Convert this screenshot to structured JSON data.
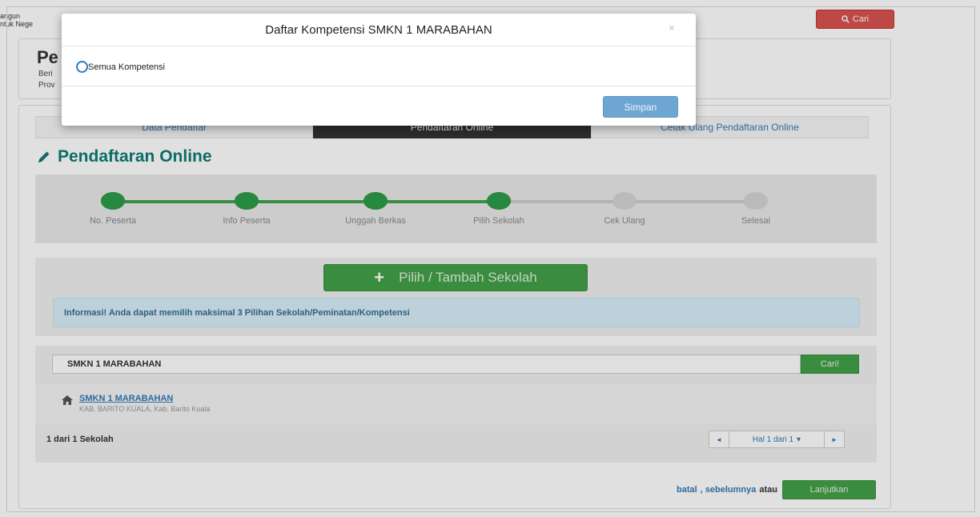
{
  "header": {
    "brand_line_1": "angun",
    "brand_line_2": "ntuk Nege",
    "search_label": "Cari",
    "search_icon": "search-icon"
  },
  "top_panel": {
    "title": "Pe",
    "line_1": "Beri",
    "line_2": "Prov"
  },
  "tabs": [
    {
      "label": "Data Pendaftar",
      "active": false
    },
    {
      "label": "Pendaftaran Online",
      "active": true
    },
    {
      "label": "Cetak Ulang Pendaftaran Online",
      "active": false
    }
  ],
  "section": {
    "title": "Pendaftaran Online",
    "icon": "pencil-icon"
  },
  "steps": [
    {
      "label": "No. Peserta",
      "done": true
    },
    {
      "label": "Info Peserta",
      "done": true
    },
    {
      "label": "Unggah Berkas",
      "done": true
    },
    {
      "label": "Pilih Sekolah",
      "done": true
    },
    {
      "label": "Cek Ulang",
      "done": false
    },
    {
      "label": "Selesai",
      "done": false
    }
  ],
  "choose": {
    "button_label": "Pilih / Tambah Sekolah",
    "plus": "+",
    "info_text": "Informasi! Anda dapat memilih maksimal 3 Pilihan Sekolah/Peminatan/Kompetensi"
  },
  "school_search": {
    "value": "SMKN 1 MARABAHAN",
    "button_label": "Cari!",
    "result_name": "SMKN 1 MARABAHAN",
    "result_address": "KAB. BARITO KUALA, Kab. Barito Kuala",
    "count_text": "1 dari 1 Sekolah",
    "pager": {
      "prev": "◄",
      "page": "Hal 1 dari 1",
      "next": "►"
    }
  },
  "footer": {
    "batal": "batal",
    "sebelumnya": ", sebelumnya",
    "atau": "atau",
    "next": "Lanjutkan"
  },
  "modal": {
    "title": "Daftar Kompetensi SMKN 1 MARABAHAN",
    "close": "×",
    "option_label": "Semua Kompetensi",
    "save_label": "Simpan"
  },
  "colors": {
    "primary_green": "#43a047",
    "teal_title": "#0d7d73",
    "danger": "#d9534f",
    "link": "#337ab7"
  }
}
